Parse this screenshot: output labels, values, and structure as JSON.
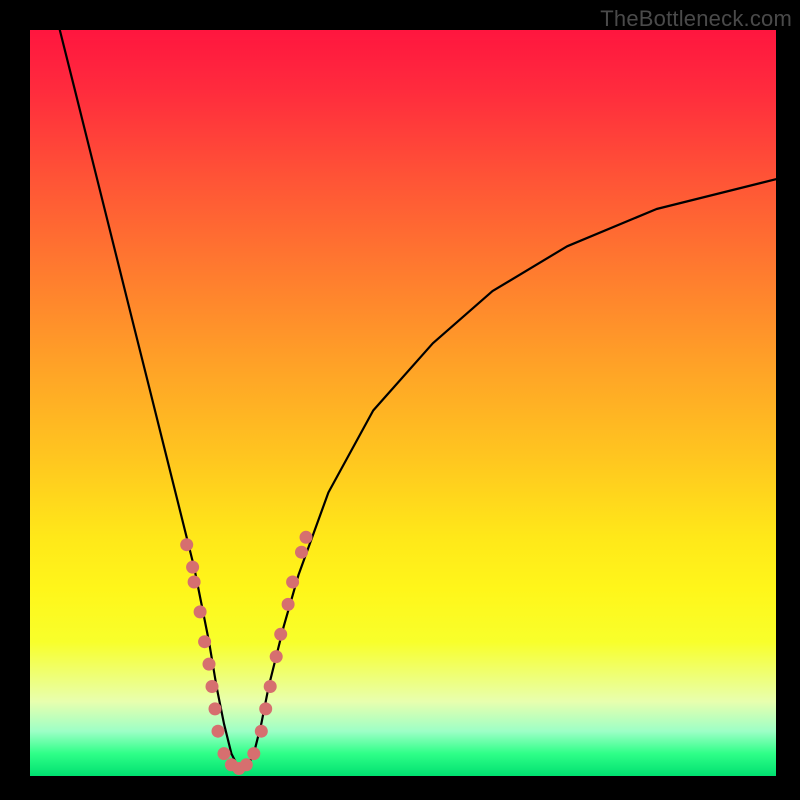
{
  "watermark": {
    "text": "TheBottleneck.com"
  },
  "colors": {
    "frame": "#000000",
    "curve": "#000000",
    "marker_fill": "#d66f6f",
    "marker_stroke": "#b54d4d"
  },
  "chart_data": {
    "type": "line",
    "title": "",
    "xlabel": "",
    "ylabel": "",
    "xlim": [
      0,
      100
    ],
    "ylim": [
      0,
      100
    ],
    "grid": false,
    "legend": false,
    "notch_x": 28,
    "series": [
      {
        "name": "bottleneck-curve",
        "x": [
          4,
          6,
          8,
          10,
          12,
          14,
          16,
          18,
          20,
          22,
          24,
          25,
          26,
          27,
          28,
          29,
          30,
          31,
          32,
          34,
          36,
          40,
          46,
          54,
          62,
          72,
          84,
          100
        ],
        "y": [
          100,
          92,
          84,
          76,
          68,
          60,
          52,
          44,
          36,
          28,
          18,
          12,
          7,
          3,
          1,
          1,
          3,
          7,
          12,
          20,
          27,
          38,
          49,
          58,
          65,
          71,
          76,
          80
        ]
      }
    ],
    "markers": {
      "name": "highlight-dots",
      "points": [
        {
          "x": 21.0,
          "y": 31
        },
        {
          "x": 21.8,
          "y": 28
        },
        {
          "x": 22.0,
          "y": 26
        },
        {
          "x": 22.8,
          "y": 22
        },
        {
          "x": 23.4,
          "y": 18
        },
        {
          "x": 24.0,
          "y": 15
        },
        {
          "x": 24.4,
          "y": 12
        },
        {
          "x": 24.8,
          "y": 9
        },
        {
          "x": 25.2,
          "y": 6
        },
        {
          "x": 26.0,
          "y": 3
        },
        {
          "x": 27.0,
          "y": 1.5
        },
        {
          "x": 28.0,
          "y": 1.0
        },
        {
          "x": 29.0,
          "y": 1.5
        },
        {
          "x": 30.0,
          "y": 3
        },
        {
          "x": 31.0,
          "y": 6
        },
        {
          "x": 31.6,
          "y": 9
        },
        {
          "x": 32.2,
          "y": 12
        },
        {
          "x": 33.0,
          "y": 16
        },
        {
          "x": 33.6,
          "y": 19
        },
        {
          "x": 34.6,
          "y": 23
        },
        {
          "x": 35.2,
          "y": 26
        },
        {
          "x": 36.4,
          "y": 30
        },
        {
          "x": 37.0,
          "y": 32
        }
      ]
    }
  }
}
